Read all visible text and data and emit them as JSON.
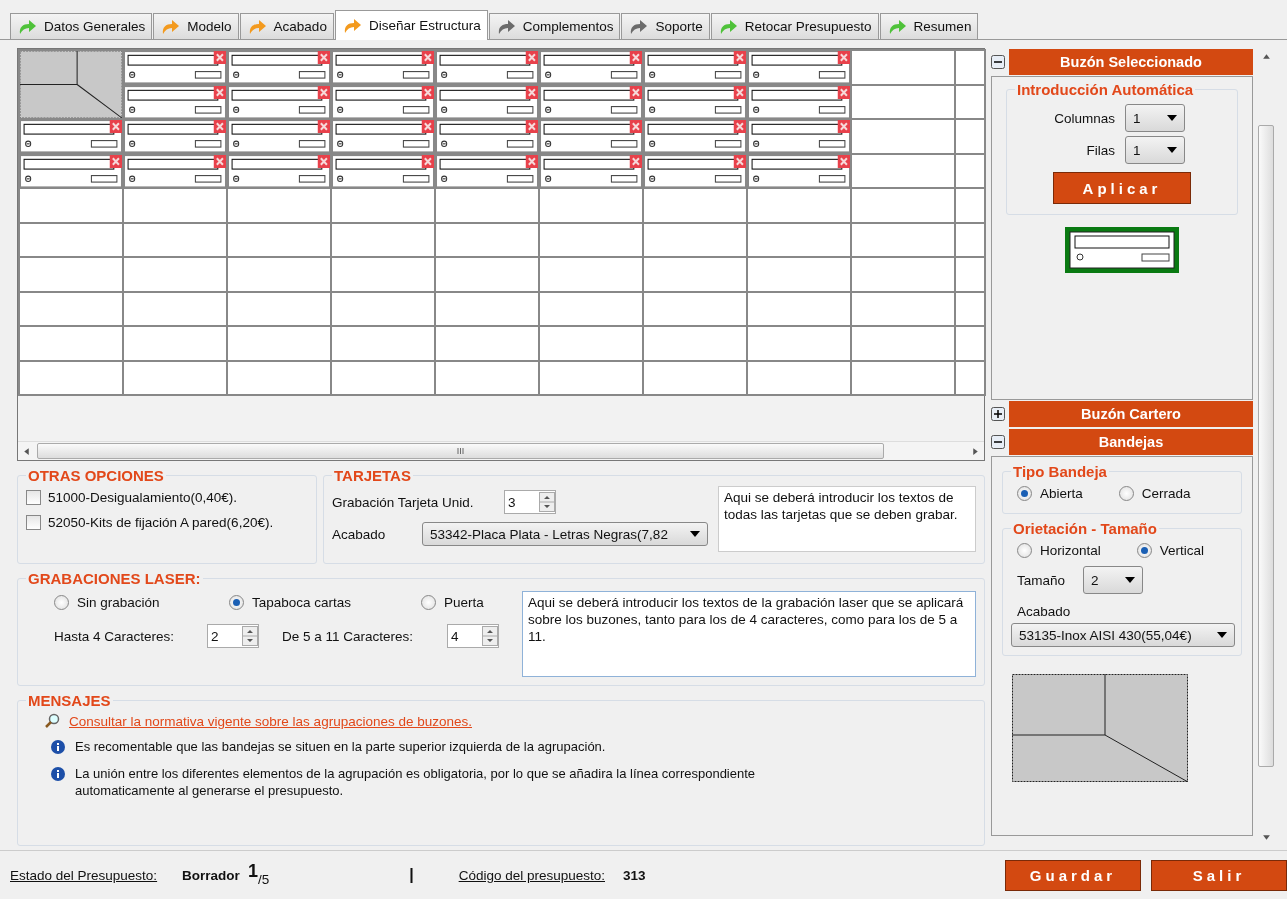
{
  "tabs": [
    {
      "label": "Datos Generales",
      "color": "#4fc23a",
      "selected": false
    },
    {
      "label": "Modelo",
      "color": "#f39a1e",
      "selected": false
    },
    {
      "label": "Acabado",
      "color": "#f39a1e",
      "selected": false
    },
    {
      "label": "Diseñar Estructura",
      "color": "#f39a1e",
      "selected": true
    },
    {
      "label": "Complementos",
      "color": "#6b6b6b",
      "selected": false
    },
    {
      "label": "Soporte",
      "color": "#6b6b6b",
      "selected": false
    },
    {
      "label": "Retocar Presupuesto",
      "color": "#4fc23a",
      "selected": false
    },
    {
      "label": "Resumen",
      "color": "#4fc23a",
      "selected": false
    }
  ],
  "grid": {
    "rows": [
      [
        {
          "kind": "tray"
        },
        {
          "kind": "mailbox"
        },
        {
          "kind": "mailbox"
        },
        {
          "kind": "mailbox"
        },
        {
          "kind": "mailbox"
        },
        {
          "kind": "mailbox"
        },
        {
          "kind": "mailbox"
        },
        {
          "kind": "mailbox"
        },
        {
          "kind": "empty"
        },
        {
          "kind": "empty"
        }
      ],
      [
        {
          "kind": "covered"
        },
        {
          "kind": "mailbox"
        },
        {
          "kind": "mailbox"
        },
        {
          "kind": "mailbox"
        },
        {
          "kind": "mailbox"
        },
        {
          "kind": "mailbox"
        },
        {
          "kind": "mailbox"
        },
        {
          "kind": "mailbox"
        },
        {
          "kind": "empty"
        },
        {
          "kind": "empty"
        }
      ],
      [
        {
          "kind": "mailbox"
        },
        {
          "kind": "mailbox"
        },
        {
          "kind": "mailbox"
        },
        {
          "kind": "mailbox"
        },
        {
          "kind": "mailbox"
        },
        {
          "kind": "mailbox"
        },
        {
          "kind": "mailbox"
        },
        {
          "kind": "mailbox"
        },
        {
          "kind": "empty"
        },
        {
          "kind": "empty"
        }
      ],
      [
        {
          "kind": "mailbox"
        },
        {
          "kind": "mailbox"
        },
        {
          "kind": "mailbox"
        },
        {
          "kind": "mailbox"
        },
        {
          "kind": "mailbox"
        },
        {
          "kind": "mailbox"
        },
        {
          "kind": "mailbox"
        },
        {
          "kind": "mailbox"
        },
        {
          "kind": "empty"
        },
        {
          "kind": "empty"
        }
      ],
      [
        {
          "kind": "empty"
        },
        {
          "kind": "empty"
        },
        {
          "kind": "empty"
        },
        {
          "kind": "empty"
        },
        {
          "kind": "empty"
        },
        {
          "kind": "empty"
        },
        {
          "kind": "empty"
        },
        {
          "kind": "empty"
        },
        {
          "kind": "empty"
        },
        {
          "kind": "empty"
        }
      ],
      [
        {
          "kind": "empty"
        },
        {
          "kind": "empty"
        },
        {
          "kind": "empty"
        },
        {
          "kind": "empty"
        },
        {
          "kind": "empty"
        },
        {
          "kind": "empty"
        },
        {
          "kind": "empty"
        },
        {
          "kind": "empty"
        },
        {
          "kind": "empty"
        },
        {
          "kind": "empty"
        }
      ],
      [
        {
          "kind": "empty"
        },
        {
          "kind": "empty"
        },
        {
          "kind": "empty"
        },
        {
          "kind": "empty"
        },
        {
          "kind": "empty"
        },
        {
          "kind": "empty"
        },
        {
          "kind": "empty"
        },
        {
          "kind": "empty"
        },
        {
          "kind": "empty"
        },
        {
          "kind": "empty"
        }
      ],
      [
        {
          "kind": "empty"
        },
        {
          "kind": "empty"
        },
        {
          "kind": "empty"
        },
        {
          "kind": "empty"
        },
        {
          "kind": "empty"
        },
        {
          "kind": "empty"
        },
        {
          "kind": "empty"
        },
        {
          "kind": "empty"
        },
        {
          "kind": "empty"
        },
        {
          "kind": "empty"
        }
      ],
      [
        {
          "kind": "empty"
        },
        {
          "kind": "empty"
        },
        {
          "kind": "empty"
        },
        {
          "kind": "empty"
        },
        {
          "kind": "empty"
        },
        {
          "kind": "empty"
        },
        {
          "kind": "empty"
        },
        {
          "kind": "empty"
        },
        {
          "kind": "empty"
        },
        {
          "kind": "empty"
        }
      ],
      [
        {
          "kind": "empty"
        },
        {
          "kind": "empty"
        },
        {
          "kind": "empty"
        },
        {
          "kind": "empty"
        },
        {
          "kind": "empty"
        },
        {
          "kind": "empty"
        },
        {
          "kind": "empty"
        },
        {
          "kind": "empty"
        },
        {
          "kind": "empty"
        },
        {
          "kind": "empty"
        }
      ]
    ],
    "scroll_grip": "III"
  },
  "otras_opciones": {
    "title": "OTRAS OPCIONES",
    "options": [
      {
        "label": "51000-Desigualamiento(0,40€).",
        "checked": false
      },
      {
        "label": "52050-Kits de fijación A pared(6,20€).",
        "checked": false
      }
    ]
  },
  "tarjetas": {
    "title": "TARJETAS",
    "grabacion_label": "Grabación Tarjeta Unid.",
    "grabacion_value": "3",
    "acabado_label": "Acabado",
    "acabado_value": "53342-Placa Plata - Letras Negras(7,82",
    "note": "Aqui se deberá introducir los textos de todas las tarjetas que se deben grabar."
  },
  "grabaciones_laser": {
    "title": "GRABACIONES LASER:",
    "modes": [
      {
        "label": "Sin grabación",
        "selected": false
      },
      {
        "label": "Tapaboca cartas",
        "selected": true
      },
      {
        "label": "Puerta",
        "selected": false
      }
    ],
    "hasta_label": "Hasta 4 Caracteres:",
    "hasta_value": "2",
    "de5_label": "De 5 a 11 Caracteres:",
    "de5_value": "4",
    "text": "Aqui se deberá introducir los textos de la grabación laser que se aplicará sobre los buzones, tanto para los de 4 caracteres, como para los de 5 a 11."
  },
  "mensajes": {
    "title": "MENSAJES",
    "link": "Consultar la normativa vigente sobre las agrupaciones de buzones.",
    "items": [
      "Es recomentable que las bandejas se situen en la parte superior izquierda de la agrupación.",
      "La unión entre los diferentes elementos de la agrupación es obligatoria, por lo que se añadira la línea correspondiente automaticamente al generarse el presupuesto."
    ]
  },
  "panel": {
    "sections": [
      {
        "title": "Buzón Seleccionado",
        "expanded": true
      },
      {
        "title": "Buzón Cartero",
        "expanded": false
      },
      {
        "title": "Bandejas",
        "expanded": true
      }
    ],
    "intro": {
      "title": "Introducción Automática",
      "columnas_label": "Columnas",
      "columnas_value": "1",
      "filas_label": "Filas",
      "filas_value": "1",
      "apply": "Aplicar"
    },
    "tipo_bandeja": {
      "title": "Tipo Bandeja",
      "options": [
        {
          "label": "Abierta",
          "selected": true
        },
        {
          "label": "Cerrada",
          "selected": false
        }
      ]
    },
    "orientacion": {
      "title": "Orietación - Tamaño",
      "options": [
        {
          "label": "Horizontal",
          "selected": false
        },
        {
          "label": "Vertical",
          "selected": true
        }
      ],
      "tamano_label": "Tamaño",
      "tamano_value": "2",
      "acabado_label": "Acabado",
      "acabado_value": "53135-Inox AISI 430(55,04€)"
    }
  },
  "status": {
    "estado_label": "Estado del Presupuesto:",
    "estado_value": "Borrador",
    "step": "1",
    "total": "/5",
    "separator": "|",
    "codigo_label": "Código del presupuesto:",
    "codigo_value": "313"
  },
  "buttons": [
    {
      "label": "Guardar"
    },
    {
      "label": "Salir"
    }
  ]
}
